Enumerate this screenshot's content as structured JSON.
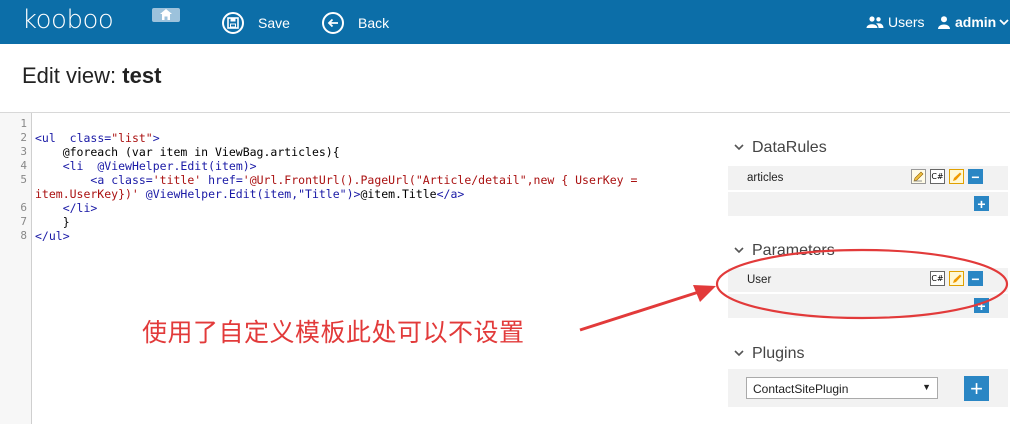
{
  "header": {
    "logo": "kooboo",
    "save_label": "Save",
    "back_label": "Back",
    "users_label": "Users",
    "admin_label": "admin"
  },
  "title": {
    "prefix": "Edit view: ",
    "name": "test"
  },
  "editor": {
    "line_numbers": [
      "1",
      "2",
      "3",
      "4",
      "5",
      "6",
      "7",
      "8"
    ]
  },
  "panel": {
    "datarules": {
      "heading": "DataRules",
      "items": [
        "articles"
      ]
    },
    "parameters": {
      "heading": "Parameters",
      "items": [
        "User"
      ]
    },
    "plugins": {
      "heading": "Plugins",
      "selected": "ContactSitePlugin"
    }
  },
  "annotation": {
    "text": "使用了自定义模板此处可以不设置",
    "color": "#e23a3a"
  },
  "colors": {
    "header_bg": "#0c6ea8",
    "accent": "#2a86c4"
  }
}
